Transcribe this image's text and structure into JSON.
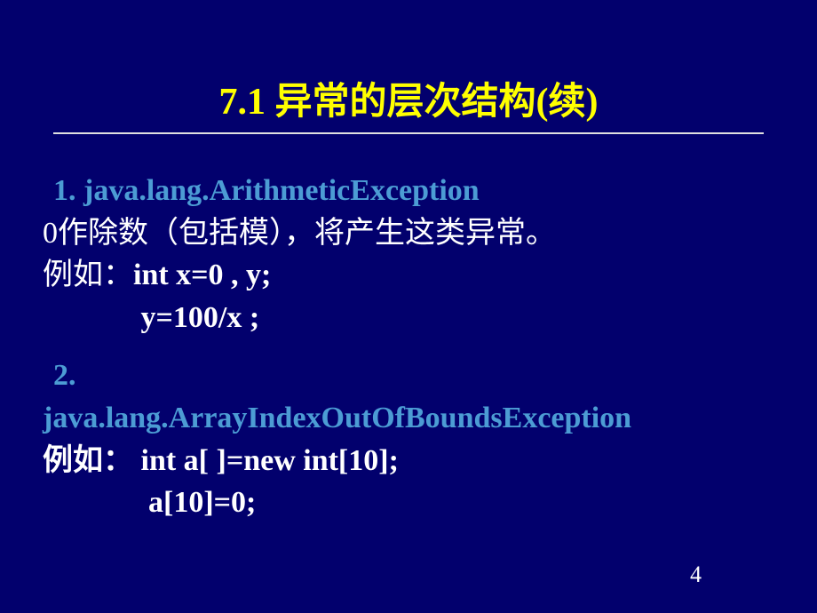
{
  "title": "7.1  异常的层次结构(续)",
  "item1": {
    "heading": "1.   java.lang.ArithmeticException",
    "desc": " 0作除数（包括模），将产生这类异常。",
    "example_label": "例如：",
    "code1": "int  x=0 , y;",
    "code2": "             y=100/x ;"
  },
  "item2": {
    "num": " 2.",
    "exception": "java.lang.ArrayIndexOutOfBoundsException",
    "example_label_prefix": " 例如：",
    "code1": " int  a[ ]=new int[10];",
    "code2": "              a[10]=0;"
  },
  "page_number": "4"
}
